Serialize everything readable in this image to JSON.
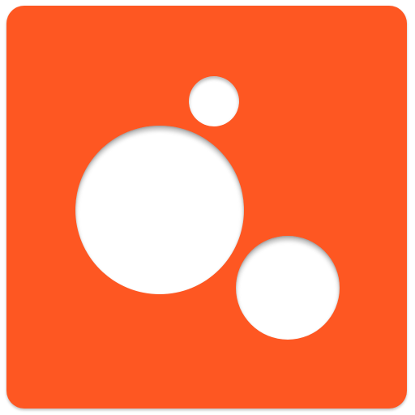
{
  "icon": {
    "name": "app-logo",
    "background_color": "#fe5722",
    "hole_color": "#ffffff",
    "elements": [
      "small-circle",
      "large-circle",
      "medium-circle"
    ]
  }
}
